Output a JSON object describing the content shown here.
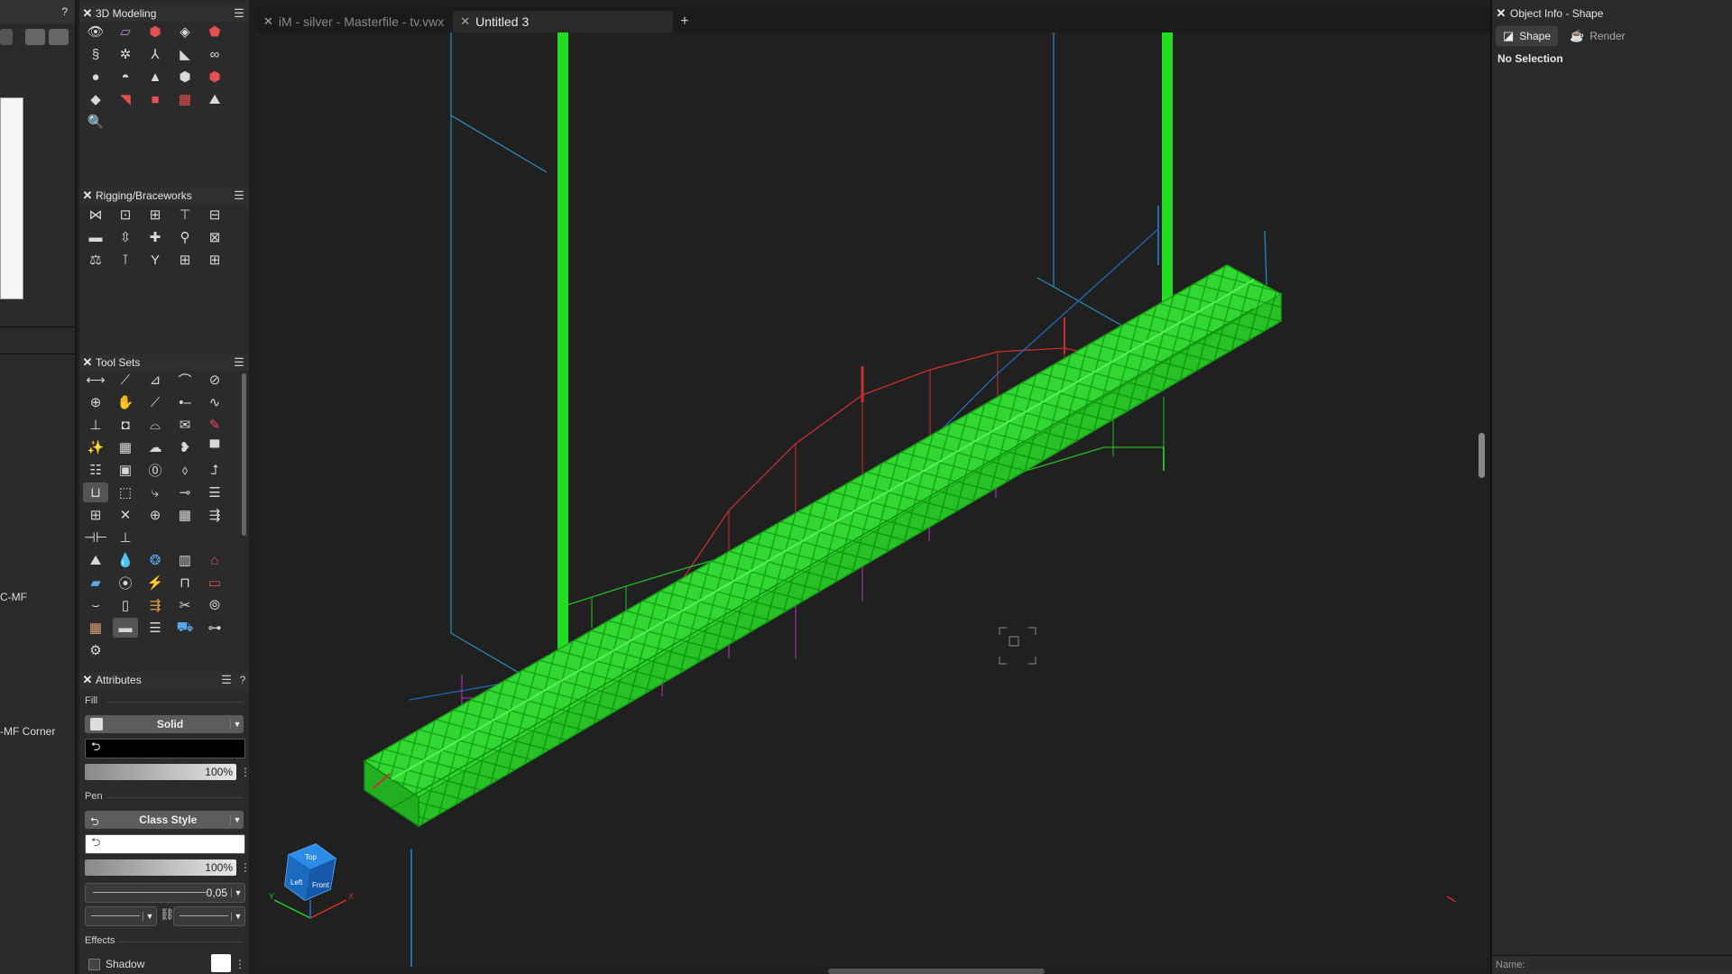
{
  "left_strip": {
    "help_symbol": "?",
    "clipped_labels": [
      "C-MF",
      "-MF Corner"
    ]
  },
  "palettes": {
    "modeling": {
      "title": "3D Modeling",
      "tools": [
        "view-icon",
        "extrude-icon",
        "extrude-box-icon",
        "box-icon",
        "red-solid-icon",
        "sweep-icon",
        "gear-light-icon",
        "axis-icon",
        "surface-icon",
        "loop-icon",
        "sphere-icon",
        "hemisphere-icon",
        "cone-icon",
        "solid-addition-icon",
        "solid-subtraction-icon",
        "shell-icon",
        "fillet-icon",
        "cube-red-icon",
        "mesh-icon",
        "deform-icon",
        "magnifier-icon"
      ]
    },
    "rigging": {
      "title": "Rigging/Braceworks",
      "tools": [
        "hoist-icon",
        "bridle-icon",
        "truss-icon",
        "truss-insert-icon",
        "truss-cross-icon",
        "pipe-icon",
        "load-icon",
        "cross-icon",
        "hanging-icon",
        "truss-system-icon",
        "weight-icon",
        "clamp-icon",
        "bridle-y-icon",
        "truss-tool-icon",
        "truss-tool-2-icon"
      ]
    },
    "toolsets": {
      "title": "Tool Sets",
      "tools": [
        "dimension-icon",
        "polyline-icon",
        "angle-icon",
        "arc-icon",
        "no-icon",
        "locus-icon",
        "hand-icon",
        "stair-icon",
        "point-line-icon",
        "wave-icon",
        "anchor-icon",
        "door-icon",
        "arch-icon",
        "note-icon",
        "pencil-icon",
        "wand-icon",
        "block-icon",
        "cloud-icon",
        "tag-icon",
        "bar-icon",
        "list-icon",
        "window-icon",
        "label-icon",
        "arrow-icon",
        "route-icon",
        "stage-icon",
        "cube-tool-icon",
        "rotate-icon",
        "slider-icon",
        "text-icon",
        "truss-grid-icon",
        "cross-lines-icon",
        "globe-icon",
        "grid-icon",
        "arrow-split-icon",
        "measure-icon",
        "ruler-icon",
        "terrain-icon",
        "drop-icon",
        "rotate-3d-icon",
        "table-icon",
        "venue-icon",
        "monitor-icon",
        "cable-icon",
        "lightning-icon",
        "seating-icon",
        "screen-icon",
        "sofa-icon",
        "pillar-icon",
        "spot-icon",
        "scissors-icon",
        "camera-icon",
        "crate-icon",
        "truss-block-icon",
        "align-icon",
        "forklift-icon",
        "connector-icon",
        "settings-icon"
      ]
    }
  },
  "attributes": {
    "title": "Attributes",
    "help_symbol": "?",
    "fill_label": "Fill",
    "fill_type": "Solid",
    "fill_color": "#000000",
    "fill_opacity": "100%",
    "pen_label": "Pen",
    "pen_style": "Class Style",
    "pen_color": "#ffffff",
    "pen_opacity": "100%",
    "line_weight": "0,05",
    "effects_label": "Effects",
    "shadow_label": "Shadow"
  },
  "tabs": [
    {
      "label": "iM - silver - Masterfile - tv.vwx",
      "active": false
    },
    {
      "label": "Untitled 3",
      "active": true
    }
  ],
  "add_tab_symbol": "+",
  "view_cube": {
    "faces": [
      "Top",
      "Front",
      "Left"
    ],
    "axes": [
      "Y",
      "X"
    ]
  },
  "object_info": {
    "title": "Object Info - Shape",
    "tabs": [
      "Shape",
      "Render"
    ],
    "selection_status": "No Selection",
    "name_label": "Name:"
  },
  "colors": {
    "truss": "#22dd22",
    "accent_red": "#d03030",
    "accent_blue": "#1f7bd1",
    "magenta": "#c040c0",
    "cyan_wire": "#2a8fc0",
    "viewport_bg": "#202020"
  }
}
